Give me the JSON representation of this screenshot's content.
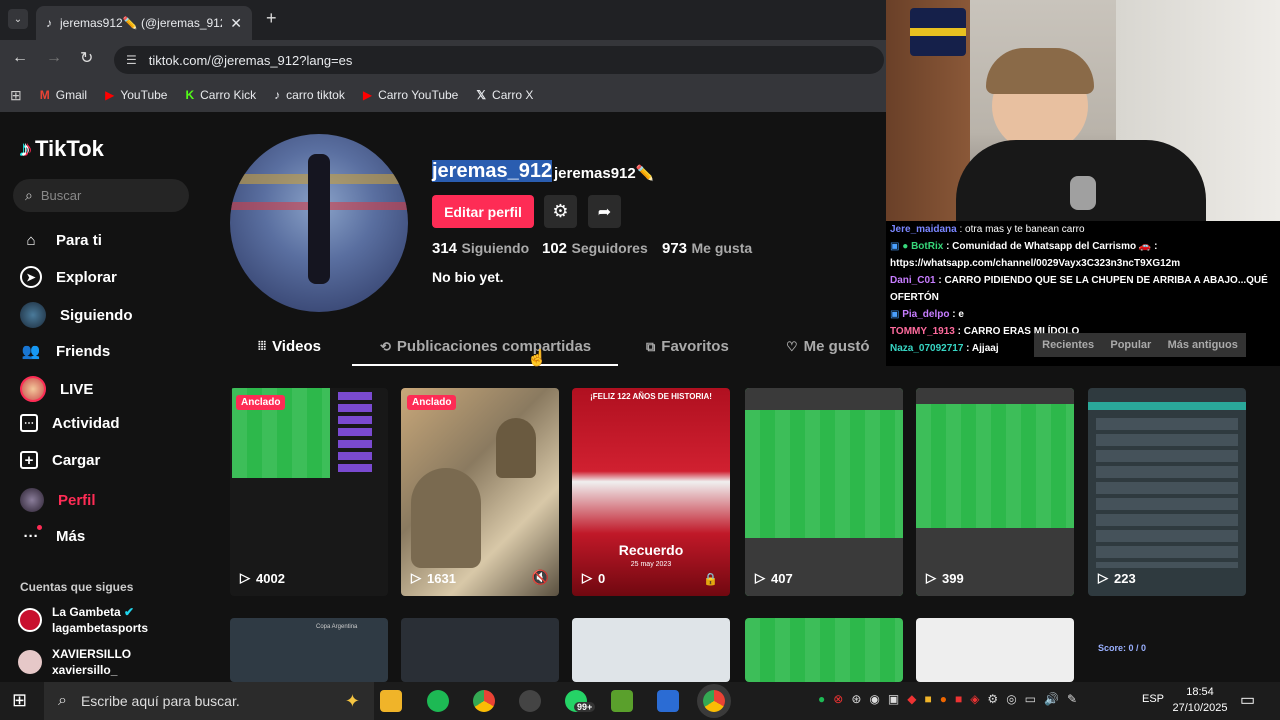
{
  "browser": {
    "tab_title": "jeremas912✏️ (@jeremas_912)",
    "url": "tiktok.com/@jeremas_912?lang=es",
    "bookmarks": [
      "Gmail",
      "YouTube",
      "Carro Kick",
      "carro tiktok",
      "Carro YouTube",
      "Carro X"
    ]
  },
  "sidebar": {
    "logo": "TikTok",
    "search_placeholder": "Buscar",
    "items": [
      {
        "label": "Para ti",
        "icon": "home-icon"
      },
      {
        "label": "Explorar",
        "icon": "compass-icon"
      },
      {
        "label": "Siguiendo",
        "icon": "following-avatar-icon"
      },
      {
        "label": "Friends",
        "icon": "friends-icon"
      },
      {
        "label": "LIVE",
        "icon": "live-avatar-icon"
      },
      {
        "label": "Actividad",
        "icon": "activity-icon"
      },
      {
        "label": "Cargar",
        "icon": "upload-icon"
      },
      {
        "label": "Perfil",
        "icon": "profile-avatar-icon"
      },
      {
        "label": "Más",
        "icon": "more-icon"
      }
    ],
    "following_title": "Cuentas que sigues",
    "following": [
      {
        "name": "La Gambeta",
        "handle": "lagambetasports",
        "verified": true
      },
      {
        "name": "XAVIERSILLO",
        "handle": "xaviersillo_",
        "verified": false
      }
    ]
  },
  "profile": {
    "username": "jeremas_912",
    "nickname": "jeremas912✏️",
    "edit_label": "Editar perfil",
    "stats": [
      {
        "value": "314",
        "label": "Siguiendo"
      },
      {
        "value": "102",
        "label": "Seguidores"
      },
      {
        "value": "973",
        "label": "Me gusta"
      }
    ],
    "bio": "No bio yet."
  },
  "tabs": [
    "Videos",
    "Publicaciones compartidas",
    "Favoritos",
    "Me gustó"
  ],
  "videos": [
    {
      "views": "4002",
      "pinned": "Anclado"
    },
    {
      "views": "1631",
      "pinned": "Anclado"
    },
    {
      "views": "0",
      "pinned": "",
      "overlay": "Recuerdo",
      "sub": "25 may 2023",
      "top": "¡FELIZ 122 AÑOS DE HISTORIA!"
    },
    {
      "views": "407",
      "pinned": ""
    },
    {
      "views": "399",
      "pinned": ""
    },
    {
      "views": "223",
      "pinned": ""
    }
  ],
  "second_row": {
    "label_1": "Copa Argentina",
    "score_text": "Score: 0 / 0"
  },
  "chat": {
    "messages": [
      {
        "user": "Jere_maidana",
        "text": " : otra mas y te banean carro",
        "color": "#7a86ff"
      },
      {
        "user": "BotRix",
        "text": " : Comunidad de Whatsapp del Carrismo 🚗 :",
        "color": "#37d67a",
        "badges": true
      },
      {
        "user": "",
        "text": "https://whatsapp.com/channel/0029Vayx3C323n3ncT9XG12m",
        "color": "#fff"
      },
      {
        "user": "Dani_C01",
        "text": " : CARRO PIDIENDO QUE SE LA CHUPEN DE ARRIBA A ABAJO...QUÉ",
        "color": "#c77dff"
      },
      {
        "user": "",
        "text": "OFERTÓN",
        "color": "#fff"
      },
      {
        "user": "Pia_delpo",
        "text": " : e",
        "color": "#c77dff",
        "badges": true
      },
      {
        "user": "TOMMY_1913",
        "text": " : CARRO ERAS MI ÍDOLO",
        "color": "#ff6b9d"
      },
      {
        "user": "Naza_07092717",
        "text": " : Ajjaaj",
        "color": "#37d6c4"
      }
    ],
    "filters": [
      "Recientes",
      "Popular",
      "Más antiguos"
    ]
  },
  "taskbar": {
    "search_placeholder": "Escribe aquí para buscar.",
    "badge": "99+",
    "lang": "ESP",
    "time": "18:54",
    "date": "27/10/2025"
  }
}
